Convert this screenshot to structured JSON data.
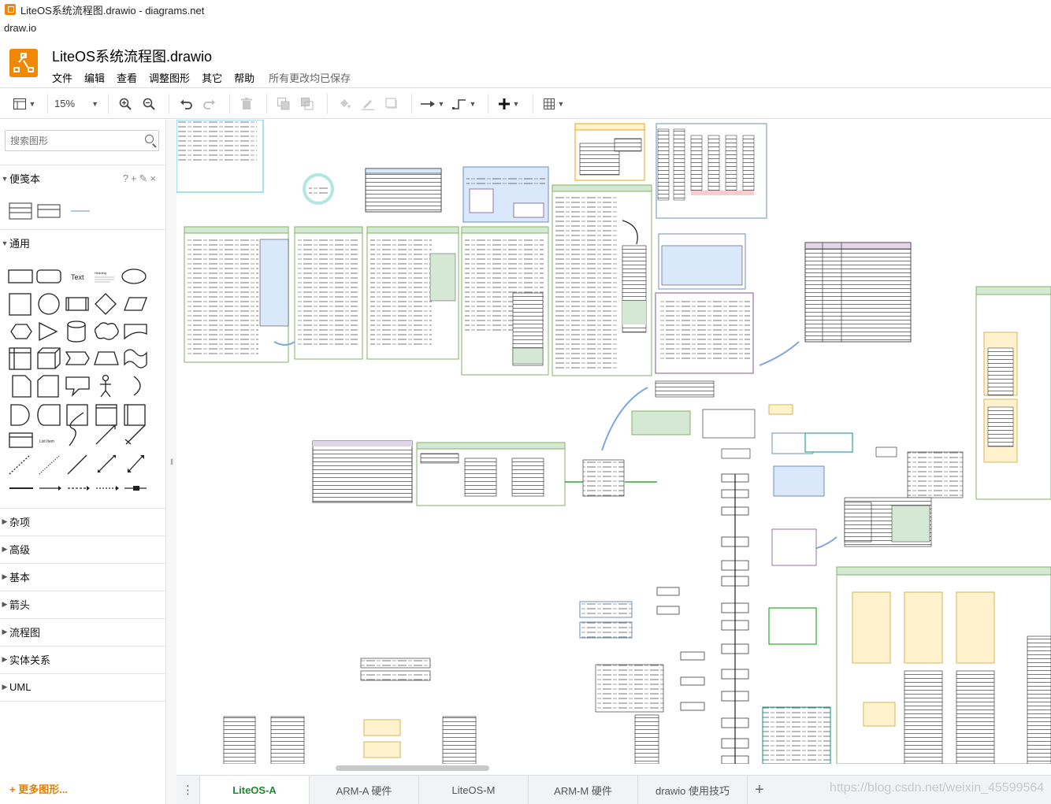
{
  "window": {
    "title": "LiteOS系统流程图.drawio - diagrams.net",
    "url": "draw.io"
  },
  "header": {
    "doc_title": "LiteOS系统流程图.drawio",
    "menus": [
      "文件",
      "编辑",
      "查看",
      "调整图形",
      "其它",
      "帮助"
    ],
    "save_status": "所有更改均已保存"
  },
  "toolbar": {
    "zoom": "15%"
  },
  "sidebar": {
    "search_placeholder": "搜索图形",
    "sections": {
      "scratchpad": "便笺本",
      "general": "通用",
      "misc": "杂项",
      "advanced": "高级",
      "basic": "基本",
      "arrows": "箭头",
      "flowchart": "流程图",
      "er": "实体关系",
      "uml": "UML"
    },
    "shape_text_label": "Text",
    "shape_heading_label": "Heading",
    "shape_list_label": "List Item",
    "more_shapes": "更多图形..."
  },
  "pages": {
    "tabs": [
      "LiteOS-A",
      "ARM-A 硬件",
      "LiteOS-M",
      "ARM-M 硬件",
      "drawio 使用技巧"
    ],
    "active": 0
  },
  "watermark": "https://blog.csdn.net/weixin_45599564",
  "colors": {
    "brand": "#f08705",
    "active_tab": "#1e8a2e",
    "diagram_green": "#d5e8d4",
    "diagram_blue": "#dae8fc",
    "diagram_purple": "#e1d5e7",
    "diagram_yellow": "#fff2cc"
  }
}
